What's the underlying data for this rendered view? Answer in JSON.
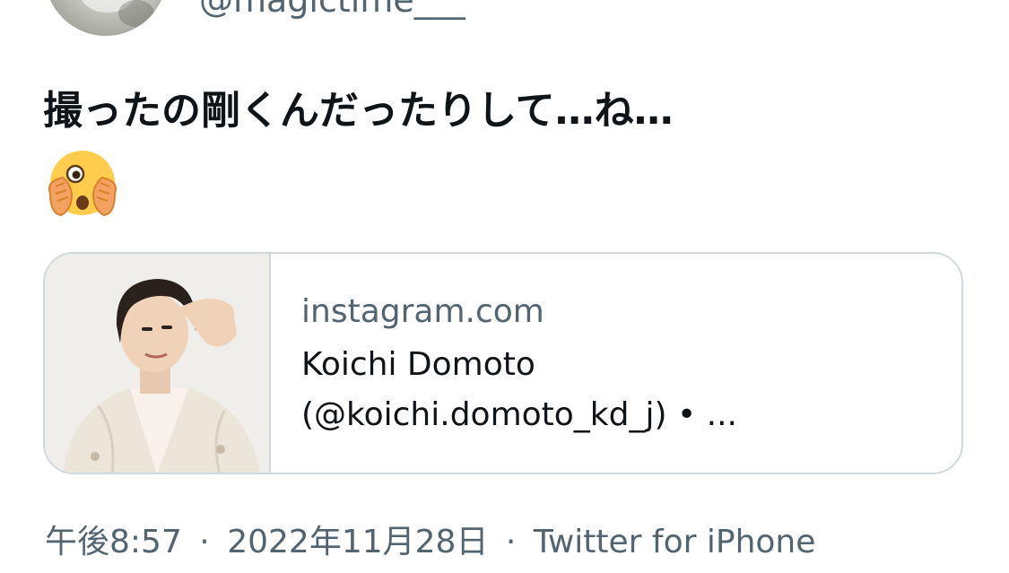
{
  "author": {
    "handle": "@magictime___"
  },
  "tweet": {
    "text": "撮ったの剛くんだったりして…ね…",
    "emoji_icon": "face-with-open-eyes-and-hand-over-mouth"
  },
  "link_card": {
    "domain": "instagram.com",
    "title_line1": "Koichi Domoto",
    "title_line2": "(@koichi.domoto_kd_j) • ..."
  },
  "meta": {
    "time": "午後8:57",
    "separator": "·",
    "date": "2022年11月28日",
    "source": "Twitter for iPhone"
  },
  "colors": {
    "text_primary": "#0f1419",
    "text_secondary": "#536471",
    "border": "#cfd9de"
  }
}
